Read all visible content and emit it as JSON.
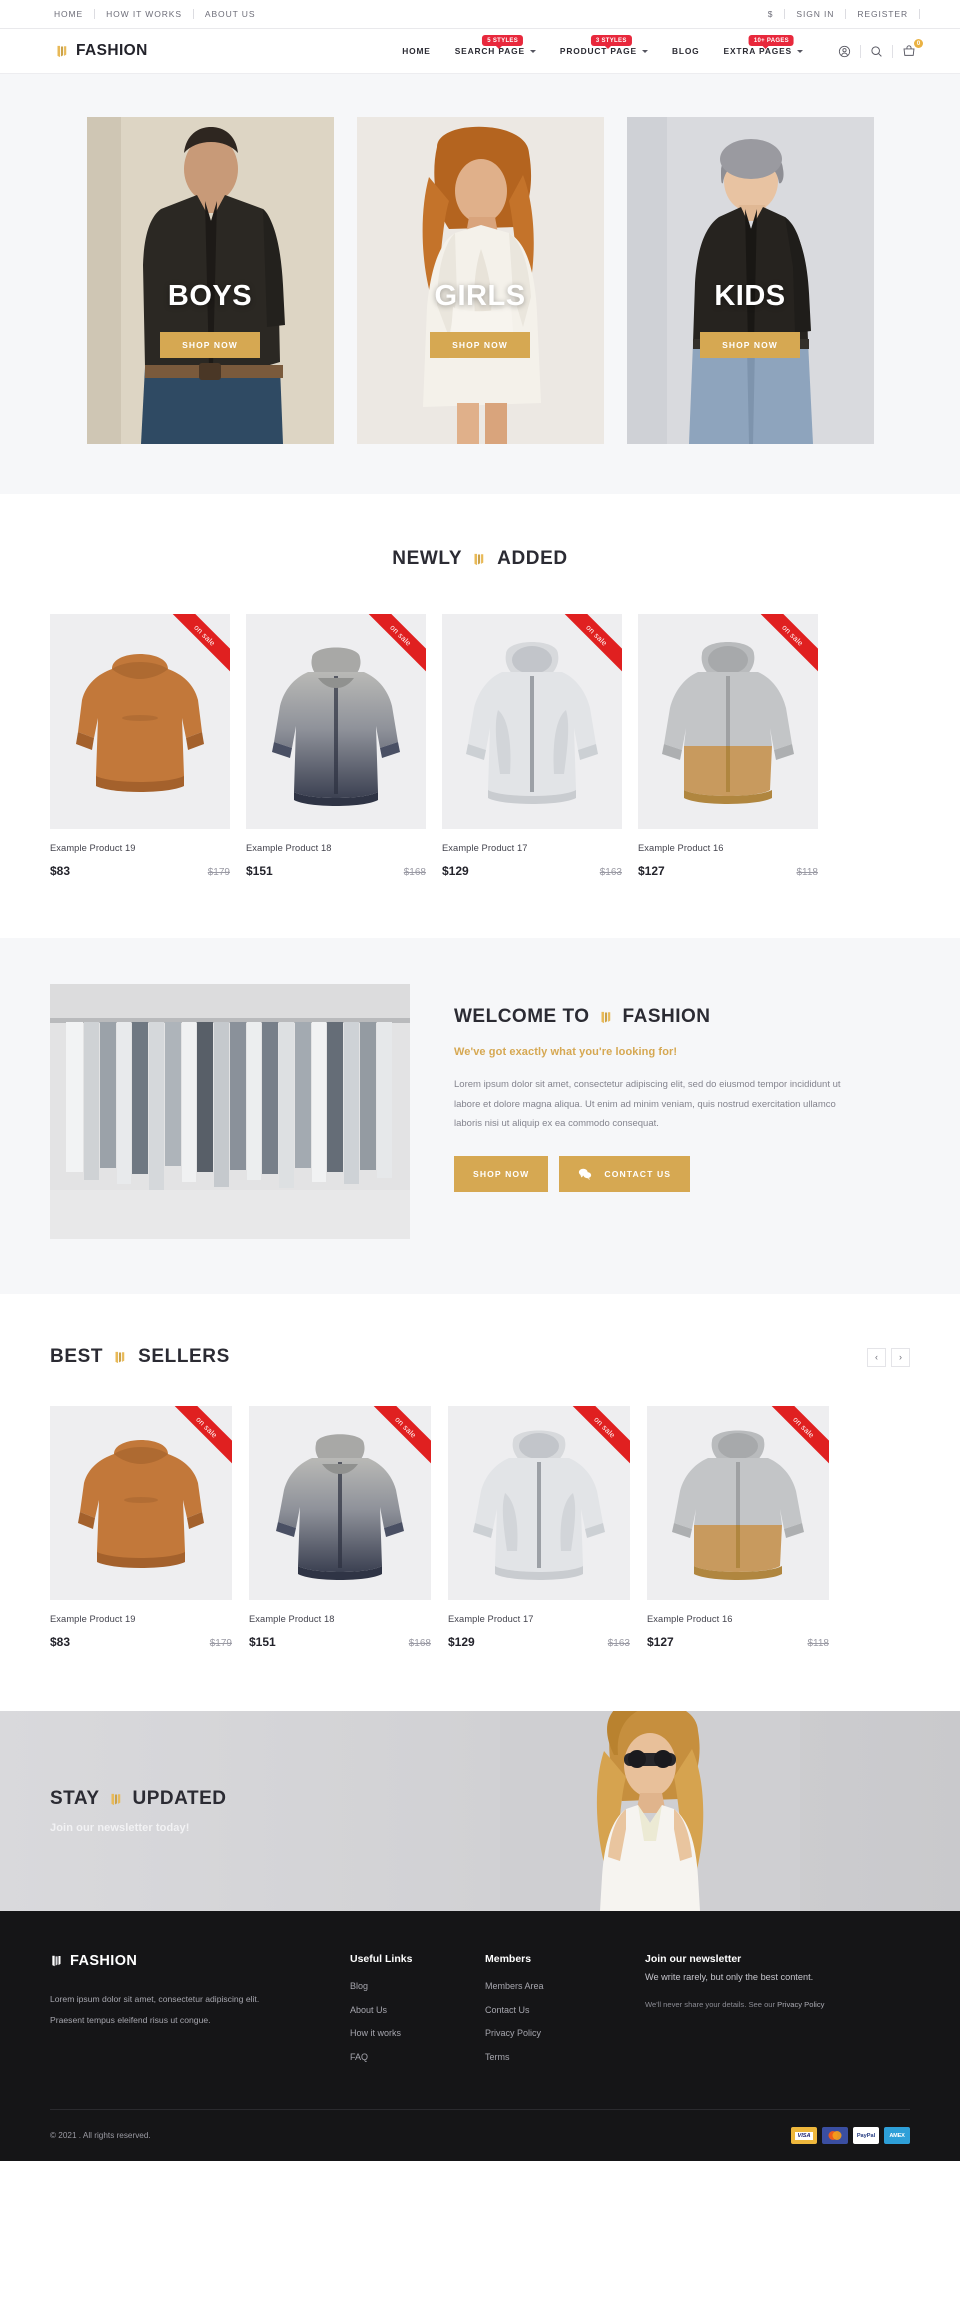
{
  "topbar": {
    "left_links": [
      "HOME",
      "HOW IT WORKS",
      "ABOUT US"
    ],
    "currency": "$",
    "right_links": [
      "SIGN IN",
      "REGISTER"
    ]
  },
  "header": {
    "brand": "FASHION",
    "logo_icon": "flag-mark-icon",
    "nav": [
      {
        "label": "HOME",
        "caret": false,
        "badge": ""
      },
      {
        "label": "SEARCH PAGE",
        "caret": true,
        "badge": "5 STYLES"
      },
      {
        "label": "PRODUCT PAGE",
        "caret": true,
        "badge": "3 STYLES"
      },
      {
        "label": "BLOG",
        "caret": false,
        "badge": ""
      },
      {
        "label": "EXTRA PAGES",
        "caret": true,
        "badge": "10+ PAGES"
      }
    ],
    "icons": [
      "account-icon",
      "search-icon",
      "cart-icon"
    ],
    "cart_count": "0"
  },
  "categories": [
    {
      "label": "BOYS",
      "button": "SHOP NOW"
    },
    {
      "label": "GIRLS",
      "button": "SHOP NOW"
    },
    {
      "label": "KIDS",
      "button": "SHOP NOW"
    }
  ],
  "newly": {
    "title_before": "NEWLY",
    "title_after": "ADDED",
    "products": [
      {
        "name": "Example Product 19",
        "price": "$83",
        "old_price": "$179",
        "badge": "on sale"
      },
      {
        "name": "Example Product 18",
        "price": "$151",
        "old_price": "$168",
        "badge": "on sale"
      },
      {
        "name": "Example Product 17",
        "price": "$129",
        "old_price": "$163",
        "badge": "on sale"
      },
      {
        "name": "Example Product 16",
        "price": "$127",
        "old_price": "$118",
        "badge": "on sale"
      }
    ]
  },
  "welcome": {
    "title_before": "WELCOME TO",
    "title_after": "FASHION",
    "subtitle": "We've got exactly what you're looking for!",
    "paragraph": "Lorem ipsum dolor sit amet, consectetur adipiscing elit, sed do eiusmod tempor incididunt ut labore et dolore magna aliqua. Ut enim ad minim veniam, quis nostrud exercitation ullamco laboris nisi ut aliquip ex ea commodo consequat.",
    "shop_button": "SHOP NOW",
    "contact_button": "CONTACT US",
    "contact_icon": "chat-bubbles-icon"
  },
  "best": {
    "title_before": "BEST",
    "title_after": "SELLERS",
    "prev_icon": "chevron-left-icon",
    "next_icon": "chevron-right-icon",
    "products": [
      {
        "name": "Example Product 19",
        "price": "$83",
        "old_price": "$179",
        "badge": "on sale"
      },
      {
        "name": "Example Product 18",
        "price": "$151",
        "old_price": "$168",
        "badge": "on sale"
      },
      {
        "name": "Example Product 17",
        "price": "$129",
        "old_price": "$163",
        "badge": "on sale"
      },
      {
        "name": "Example Product 16",
        "price": "$127",
        "old_price": "$118",
        "badge": "on sale"
      }
    ]
  },
  "stay": {
    "title_before": "STAY",
    "title_after": "UPDATED",
    "subtitle": "Join our newsletter today!"
  },
  "footer": {
    "brand": "FASHION",
    "about_line1": "Lorem ipsum dolor sit amet, consectetur adipiscing elit.",
    "about_line2": "Praesent tempus eleifend risus ut congue.",
    "useful_title": "Useful Links",
    "useful_links": [
      "Blog",
      "About Us",
      "How it works",
      "FAQ"
    ],
    "members_title": "Members",
    "members_links": [
      "Members Area",
      "Contact Us",
      "Privacy Policy",
      "Terms"
    ],
    "news_title": "Join our newsletter",
    "news_line": "We write rarely, but only the best content.",
    "news_small_prefix": "We'll never share your details. See our ",
    "news_small_link": "Privacy Policy",
    "copyright": "© 2021 . All rights reserved.",
    "payments": [
      "VISA",
      "Mastercard",
      "PayPal",
      "AMEX"
    ]
  },
  "colors": {
    "gold": "#d6a852",
    "red": "#e8283c",
    "sale_red": "#e02020",
    "dark": "#151517"
  }
}
